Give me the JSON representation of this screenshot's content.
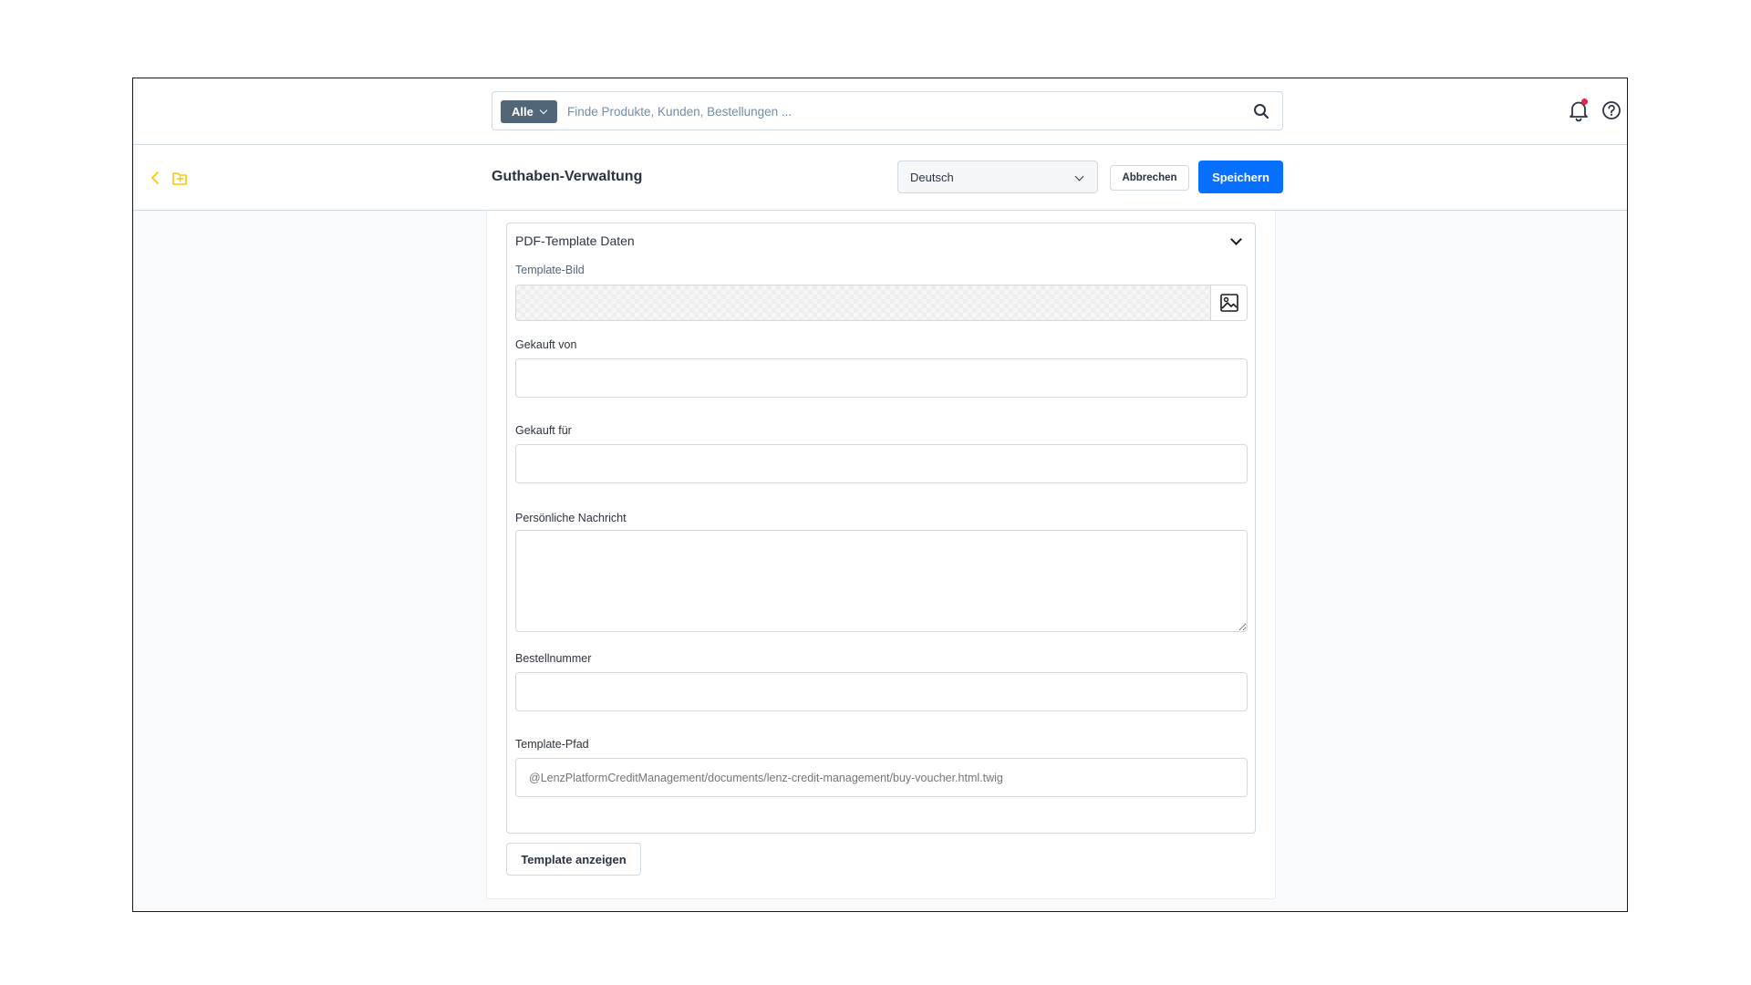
{
  "search": {
    "scope_label": "Alle",
    "placeholder": "Finde Produkte, Kunden, Bestellungen ..."
  },
  "header": {
    "title": "Guthaben-Verwaltung",
    "language": "Deutsch",
    "cancel_label": "Abbrechen",
    "save_label": "Speichern"
  },
  "section": {
    "title": "PDF-Template Daten",
    "fields": {
      "template_image_label": "Template-Bild",
      "bought_by_label": "Gekauft von",
      "bought_by_value": "",
      "bought_for_label": "Gekauft für",
      "bought_for_value": "",
      "message_label": "Persönliche Nachricht",
      "message_value": "",
      "order_number_label": "Bestellnummer",
      "order_number_value": "",
      "template_path_label": "Template-Pfad",
      "template_path_placeholder": "@LenzPlatformCreditManagement/documents/lenz-credit-management/buy-voucher.html.twig"
    }
  },
  "actions": {
    "show_template_label": "Template anzeigen"
  },
  "colors": {
    "primary": "#0870ff",
    "notification_dot": "#de294c",
    "accent_yellow": "#ffd700",
    "border": "#d1d9e0"
  }
}
